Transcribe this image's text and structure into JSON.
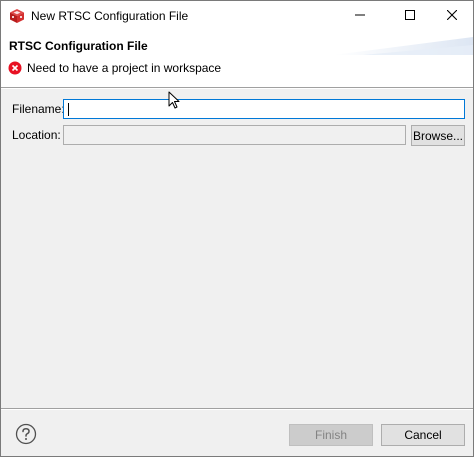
{
  "window": {
    "title": "New RTSC Configuration File",
    "icon": "cube-app-icon",
    "controls": [
      "minimize-icon",
      "maximize-icon",
      "close-icon"
    ]
  },
  "banner": {
    "title": "RTSC Configuration File",
    "message": "Need to have a project in workspace",
    "message_icon": "error-icon",
    "message_color": "#e81123"
  },
  "form": {
    "filename_label": "Filename:",
    "filename_value": "",
    "location_label": "Location:",
    "location_value": "",
    "browse_label": "Browse..."
  },
  "footer": {
    "help_icon": "help-icon",
    "finish_label": "Finish",
    "finish_enabled": false,
    "cancel_label": "Cancel"
  },
  "colors": {
    "focus_border": "#0078d7",
    "dialog_background": "#f0f0f0",
    "error": "#e81123"
  }
}
